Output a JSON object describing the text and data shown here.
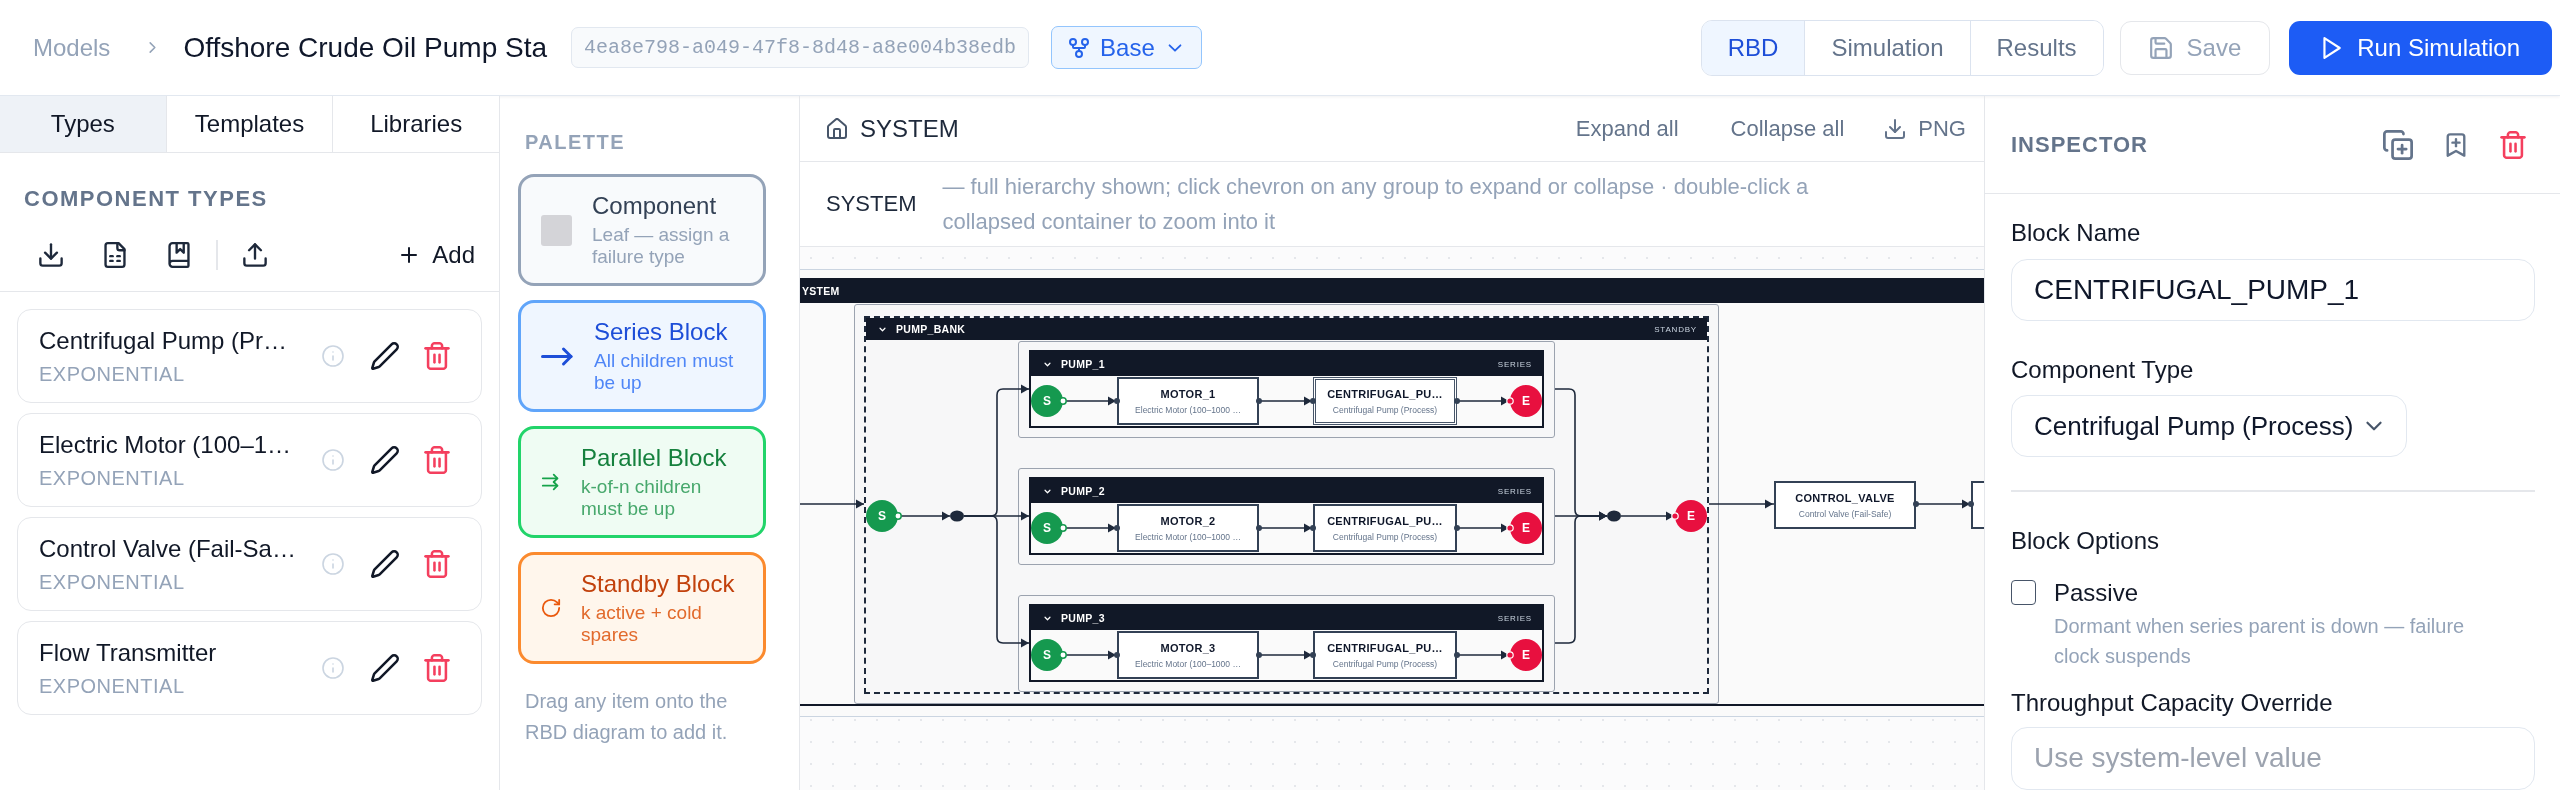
{
  "topbar": {
    "breadcrumb": "Models",
    "title": "Offshore Crude Oil Pump Sta",
    "model_id": "4ea8e798-a049-47f8-8d48-a8e004b38edb",
    "branch": "Base",
    "views": [
      {
        "label": "RBD",
        "selected": true
      },
      {
        "label": "Simulation",
        "selected": false
      },
      {
        "label": "Results",
        "selected": false
      }
    ],
    "actions": [
      {
        "kind": "save",
        "label": "Save"
      },
      {
        "kind": "run",
        "label": "Run Simulation"
      }
    ]
  },
  "sidebar": {
    "tabs": [
      {
        "label": "Types",
        "selected": true
      },
      {
        "label": "Templates",
        "selected": false
      },
      {
        "label": "Libraries",
        "selected": false
      }
    ],
    "section_title": "COMPONENT TYPES",
    "add_label": "Add",
    "component_types": [
      {
        "name": "Centrifugal Pump (Pr…",
        "distribution": "EXPONENTIAL"
      },
      {
        "name": "Electric Motor (100–1…",
        "distribution": "EXPONENTIAL"
      },
      {
        "name": "Control Valve (Fail-Sa…",
        "distribution": "EXPONENTIAL"
      },
      {
        "name": "Flow Transmitter",
        "distribution": "EXPONENTIAL"
      }
    ]
  },
  "palette": {
    "title": "PALETTE",
    "items": [
      {
        "kind": "component",
        "title": "Component",
        "description": "Leaf — assign a failure type"
      },
      {
        "kind": "series",
        "title": "Series Block",
        "description": "All children must be up"
      },
      {
        "kind": "parallel",
        "title": "Parallel Block",
        "description": "k-of-n children must be up"
      },
      {
        "kind": "standby",
        "title": "Standby Block",
        "description": "k active + cold spares"
      }
    ],
    "hint": "Drag any item onto the RBD diagram to add it."
  },
  "canvas": {
    "title": "SYSTEM",
    "actions": [
      {
        "kind": "text",
        "label": "Expand all"
      },
      {
        "kind": "text",
        "label": "Collapse all"
      },
      {
        "kind": "export",
        "label": "PNG"
      }
    ],
    "scope": "SYSTEM",
    "scope_hint": "— full hierarchy shown; click chevron on any group to expand or collapse · double-click a collapsed container to zoom into it",
    "diagram": {
      "root_label": "YSTEM",
      "group": {
        "label": "PUMP_BANK",
        "type": "STANDBY",
        "expanded": true,
        "start": "S",
        "end": "E",
        "children": [
          {
            "label": "PUMP_1",
            "type": "SERIES",
            "expanded": true,
            "start": "S",
            "end": "E",
            "blocks": [
              {
                "name": "MOTOR_1",
                "component_type": "Electric Motor (100–1000 …",
                "selected": false
              },
              {
                "name": "CENTRIFUGAL_PU…",
                "component_type": "Centrifugal Pump (Process)",
                "selected": true
              }
            ]
          },
          {
            "label": "PUMP_2",
            "type": "SERIES",
            "expanded": true,
            "start": "S",
            "end": "E",
            "blocks": [
              {
                "name": "MOTOR_2",
                "component_type": "Electric Motor (100–1000 …",
                "selected": false
              },
              {
                "name": "CENTRIFUGAL_PU…",
                "component_type": "Centrifugal Pump (Process)",
                "selected": false
              }
            ]
          },
          {
            "label": "PUMP_3",
            "type": "SERIES",
            "expanded": true,
            "start": "S",
            "end": "E",
            "blocks": [
              {
                "name": "MOTOR_3",
                "component_type": "Electric Motor (100–1000 …",
                "selected": false
              },
              {
                "name": "CENTRIFUGAL_PU…",
                "component_type": "Centrifugal Pump (Process)",
                "selected": false
              }
            ]
          }
        ]
      },
      "downstream": [
        {
          "name": "CONTROL_VALVE",
          "component_type": "Control Valve (Fail-Safe)",
          "selected": false
        },
        {
          "selected": false
        }
      ]
    }
  },
  "inspector": {
    "title": "INSPECTOR",
    "block_name": {
      "label": "Block Name",
      "value": "CENTRIFUGAL_PUMP_1"
    },
    "component_type": {
      "label": "Component Type",
      "value": "Centrifugal Pump (Process)"
    },
    "options_title": "Block Options",
    "passive": {
      "label": "Passive",
      "checked": false,
      "hint": "Dormant when series parent is down — failure clock suspends"
    },
    "capacity": {
      "label": "Throughput Capacity Override",
      "placeholder": "Use system-level value"
    }
  }
}
